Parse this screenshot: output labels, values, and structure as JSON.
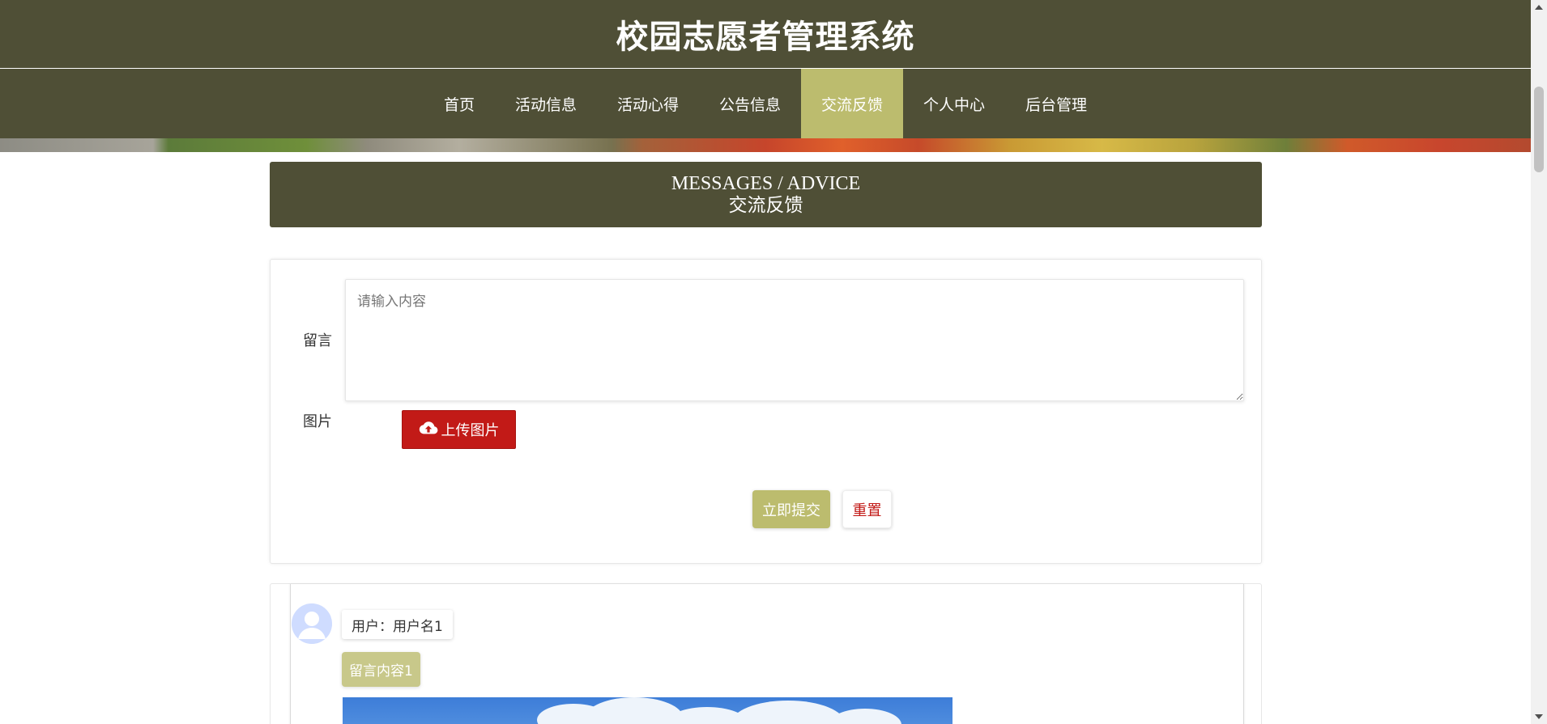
{
  "header": {
    "title": "校园志愿者管理系统"
  },
  "nav": {
    "items": [
      {
        "label": "首页",
        "active": false
      },
      {
        "label": "活动信息",
        "active": false
      },
      {
        "label": "活动心得",
        "active": false
      },
      {
        "label": "公告信息",
        "active": false
      },
      {
        "label": "交流反馈",
        "active": true
      },
      {
        "label": "个人中心",
        "active": false
      },
      {
        "label": "后台管理",
        "active": false
      }
    ]
  },
  "section": {
    "title_en": "MESSAGES / ADVICE",
    "title_cn": "交流反馈"
  },
  "form": {
    "message_label": "留言",
    "message_placeholder": "请输入内容",
    "image_label": "图片",
    "upload_label": "上传图片",
    "submit_label": "立即提交",
    "reset_label": "重置"
  },
  "messages": [
    {
      "user": "用户：用户名1",
      "content": "留言内容1"
    }
  ],
  "colors": {
    "header_bg": "#4f4f36",
    "accent": "#bcbc6e",
    "danger": "#c21a17"
  },
  "icons": {
    "upload": "cloud-upload-icon",
    "avatar": "user-avatar-icon"
  }
}
